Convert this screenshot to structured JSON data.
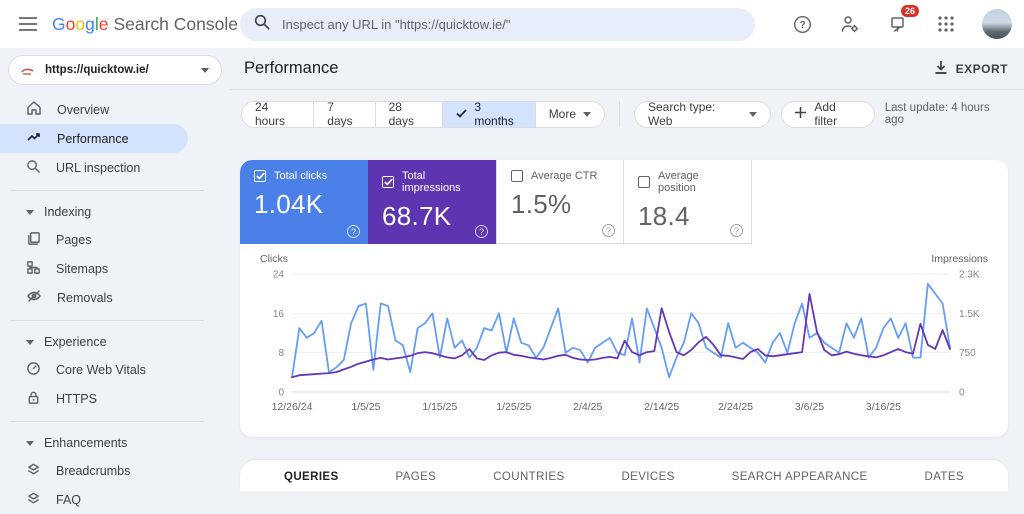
{
  "header": {
    "logo_letters": [
      "G",
      "o",
      "o",
      "g",
      "l",
      "e"
    ],
    "logo_colors": [
      "#4285f4",
      "#ea4335",
      "#fbbc05",
      "#4285f4",
      "#34a853",
      "#ea4335"
    ],
    "product_name": "Search Console",
    "search_placeholder": "Inspect any URL in \"https://quicktow.ie/\"",
    "notification_count": "26"
  },
  "property": {
    "url": "https://quicktow.ie/"
  },
  "sidebar": {
    "items": [
      {
        "label": "Overview"
      },
      {
        "label": "Performance"
      },
      {
        "label": "URL inspection"
      }
    ],
    "sections": [
      {
        "label": "Indexing",
        "items": [
          {
            "label": "Pages"
          },
          {
            "label": "Sitemaps"
          },
          {
            "label": "Removals"
          }
        ]
      },
      {
        "label": "Experience",
        "items": [
          {
            "label": "Core Web Vitals"
          },
          {
            "label": "HTTPS"
          }
        ]
      },
      {
        "label": "Enhancements",
        "items": [
          {
            "label": "Breadcrumbs"
          },
          {
            "label": "FAQ"
          }
        ]
      }
    ]
  },
  "page": {
    "title": "Performance",
    "export_label": "EXPORT",
    "last_update": "Last update: 4 hours ago"
  },
  "filters": {
    "ranges": [
      {
        "label": "24 hours",
        "selected": false
      },
      {
        "label": "7 days",
        "selected": false
      },
      {
        "label": "28 days",
        "selected": false
      },
      {
        "label": "3 months",
        "selected": true
      },
      {
        "label": "More",
        "selected": false
      }
    ],
    "search_type": "Search type: Web",
    "add_filter": "Add filter"
  },
  "cards": [
    {
      "label": "Total clicks",
      "value": "1.04K",
      "checked": true,
      "color": "#4c80e9"
    },
    {
      "label": "Total impressions",
      "value": "68.7K",
      "checked": true,
      "color": "#5e35b1"
    },
    {
      "label": "Average CTR",
      "value": "1.5%",
      "checked": false,
      "color": "#ffffff"
    },
    {
      "label": "Average position",
      "value": "18.4",
      "checked": false,
      "color": "#ffffff"
    }
  ],
  "chart_data": {
    "type": "line",
    "left_axis": {
      "label": "Clicks",
      "ticks": [
        "24",
        "16",
        "8",
        "0"
      ],
      "max": 24
    },
    "right_axis": {
      "label": "Impressions",
      "ticks": [
        "2.3K",
        "1.5K",
        "750",
        "0"
      ],
      "max": 2250
    },
    "x_ticks": [
      {
        "day": 0,
        "label": "12/26/24"
      },
      {
        "day": 10,
        "label": "1/5/25"
      },
      {
        "day": 20,
        "label": "1/15/25"
      },
      {
        "day": 30,
        "label": "1/25/25"
      },
      {
        "day": 40,
        "label": "2/4/25"
      },
      {
        "day": 50,
        "label": "2/14/25"
      },
      {
        "day": 60,
        "label": "2/24/25"
      },
      {
        "day": 70,
        "label": "3/6/25"
      },
      {
        "day": 80,
        "label": "3/16/25"
      }
    ],
    "series": [
      {
        "name": "Total clicks",
        "axis": "left",
        "color": "#669df6",
        "values": [
          3,
          13,
          11,
          12,
          14.5,
          4,
          5,
          6.5,
          14,
          17.5,
          18,
          4.5,
          18,
          17.5,
          10.5,
          9.5,
          4,
          13,
          14,
          16,
          7,
          15,
          9,
          10.5,
          7,
          9,
          13,
          12.5,
          16,
          8,
          15,
          10,
          9.5,
          7,
          9,
          13,
          17,
          8,
          9,
          8.5,
          6,
          9,
          10,
          11,
          8,
          7.5,
          15,
          6,
          17,
          13,
          9,
          3,
          7,
          10,
          16,
          14,
          9,
          8,
          7,
          14,
          9,
          10,
          9,
          8,
          6,
          10,
          12,
          8,
          14,
          18,
          11,
          12,
          10,
          9,
          8,
          14,
          11,
          15,
          7,
          9,
          13,
          15,
          11,
          14,
          7,
          7,
          22,
          20,
          18,
          9
        ]
      },
      {
        "name": "Total impressions",
        "axis": "right",
        "color": "#6637b5",
        "values": [
          280,
          320,
          330,
          340,
          350,
          360,
          380,
          430,
          480,
          540,
          580,
          620,
          650,
          620,
          640,
          660,
          690,
          740,
          760,
          740,
          700,
          660,
          640,
          700,
          820,
          640,
          610,
          700,
          750,
          760,
          710,
          690,
          660,
          640,
          620,
          650,
          690,
          710,
          650,
          620,
          610,
          620,
          650,
          670,
          640,
          980,
          760,
          700,
          760,
          780,
          1600,
          1150,
          760,
          700,
          800,
          950,
          1050,
          900,
          700,
          690,
          660,
          630,
          760,
          820,
          700,
          680,
          700,
          720,
          740,
          760,
          1870,
          1150,
          800,
          700,
          720,
          770,
          730,
          700,
          680,
          660,
          700,
          760,
          820,
          760,
          730,
          1300,
          900,
          820,
          1180,
          820
        ]
      }
    ]
  },
  "tabs": [
    {
      "label": "QUERIES",
      "active": true
    },
    {
      "label": "PAGES",
      "active": false
    },
    {
      "label": "COUNTRIES",
      "active": false
    },
    {
      "label": "DEVICES",
      "active": false
    },
    {
      "label": "SEARCH APPEARANCE",
      "active": false
    },
    {
      "label": "DATES",
      "active": false
    }
  ]
}
